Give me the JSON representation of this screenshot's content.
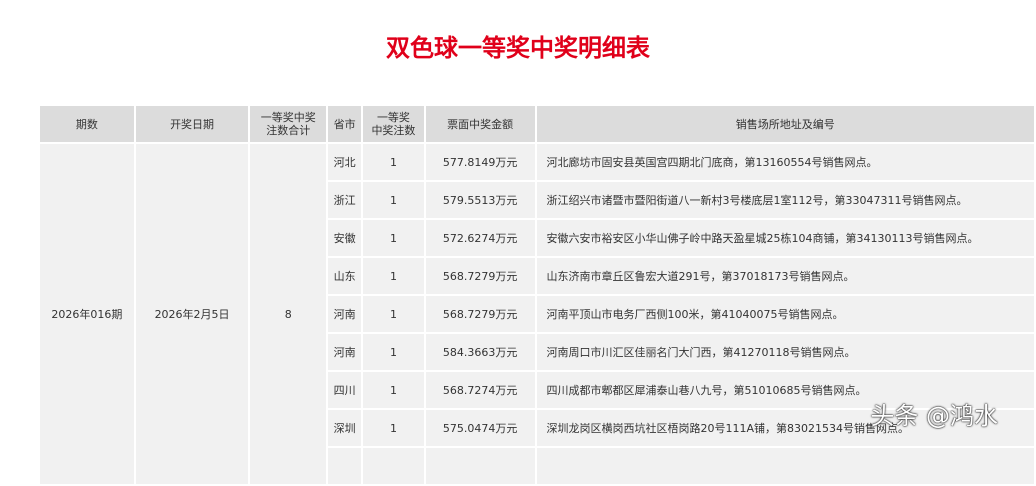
{
  "title": "双色球一等奖中奖明细表",
  "headers": [
    "期数",
    "开奖日期",
    "一等奖中奖注数合计",
    "省市",
    "一等奖中奖注数",
    "票面中奖金额",
    "销售场所地址及编号"
  ],
  "headers_split": {
    "h2a": "一等奖中奖",
    "h2b": "注数合计",
    "h4a": "一等奖",
    "h4b": "中奖注数"
  },
  "period": "2026年016期",
  "date": "2026年2月5日",
  "total": "8",
  "rows": [
    {
      "prov": "河北",
      "count": "1",
      "amount": "577.8149万元",
      "addr": "河北廊坊市固安县英国宫四期北门底商，第13160554号销售网点。"
    },
    {
      "prov": "浙江",
      "count": "1",
      "amount": "579.5513万元",
      "addr": "浙江绍兴市诸暨市暨阳街道八一新村3号楼底层1室112号，第33047311号销售网点。"
    },
    {
      "prov": "安徽",
      "count": "1",
      "amount": "572.6274万元",
      "addr": "安徽六安市裕安区小华山佛子岭中路天盈星城25栋104商铺，第34130113号销售网点。"
    },
    {
      "prov": "山东",
      "count": "1",
      "amount": "568.7279万元",
      "addr": "山东济南市章丘区鲁宏大道291号，第37018173号销售网点。"
    },
    {
      "prov": "河南",
      "count": "1",
      "amount": "568.7279万元",
      "addr": "河南平顶山市电务厂西侧100米，第41040075号销售网点。"
    },
    {
      "prov": "河南",
      "count": "1",
      "amount": "584.3663万元",
      "addr": "河南周口市川汇区佳丽名门大门西，第41270118号销售网点。"
    },
    {
      "prov": "四川",
      "count": "1",
      "amount": "568.7274万元",
      "addr": "四川成都市郫都区犀浦泰山巷八九号，第51010685号销售网点。"
    },
    {
      "prov": "深圳",
      "count": "1",
      "amount": "575.0474万元",
      "addr": "深圳龙岗区横岗西坑社区梧岗路20号111A铺，第83021534号销售网点。"
    }
  ],
  "watermark": "头条 @鸿水"
}
